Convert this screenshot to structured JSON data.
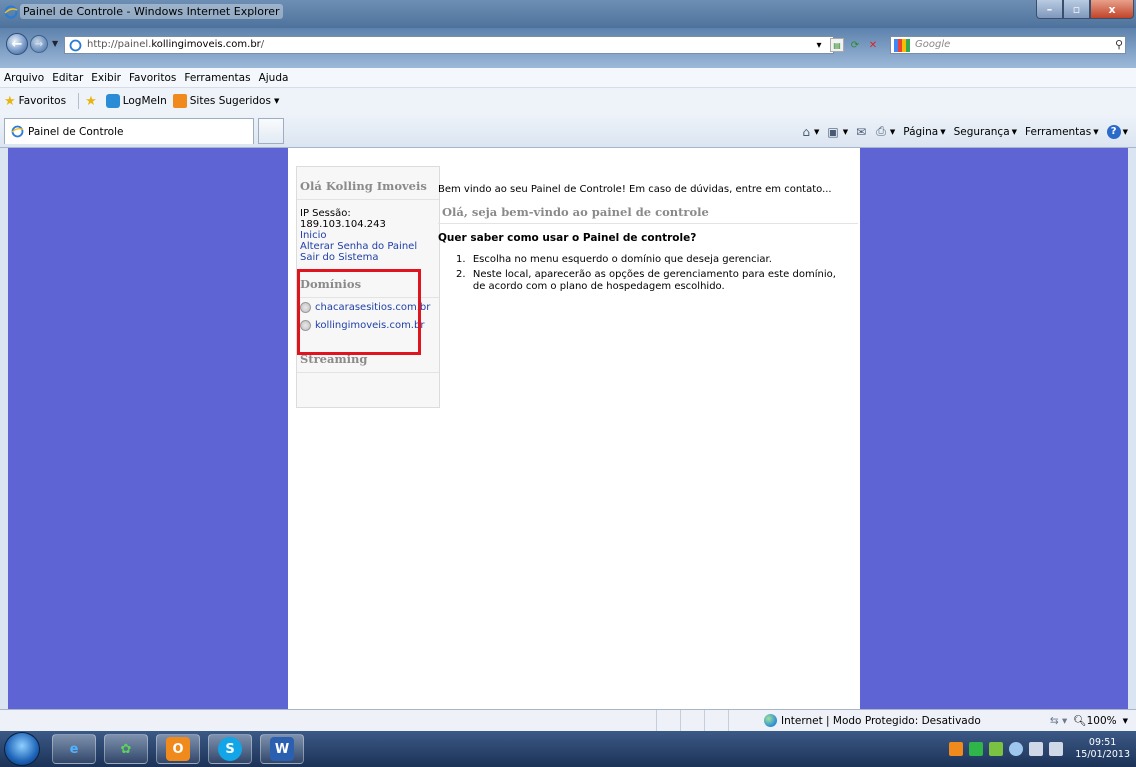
{
  "window": {
    "title": "Painel de Controle - Windows Internet Explorer",
    "controls": [
      "–",
      "▫",
      "x"
    ]
  },
  "address_bar": {
    "url_prefix": "http://painel.",
    "url_domain": "kollingimoveis.com.br",
    "url_suffix": "/",
    "search_placeholder": "Google"
  },
  "menu": [
    "Arquivo",
    "Editar",
    "Exibir",
    "Favoritos",
    "Ferramentas",
    "Ajuda"
  ],
  "favorites_bar": {
    "favorites_label": "Favoritos",
    "items": [
      "LogMeIn",
      "Sites Sugeridos"
    ]
  },
  "tab": {
    "label": "Painel de Controle"
  },
  "command_bar": {
    "page_label": "Página",
    "security_label": "Segurança",
    "tools_label": "Ferramentas"
  },
  "sidebar": {
    "greeting": "Olá Kolling Imoveis",
    "ip_session": "IP Sessão: 189.103.104.243",
    "links": [
      "Inicio",
      "Alterar Senha do Painel",
      "Sair do Sistema"
    ],
    "domains_title": "Domínios",
    "domains": [
      "chacarasesitios.com.br",
      "kollingimoveis.com.br"
    ],
    "streaming_title": "Streaming"
  },
  "main": {
    "welcome": "Bem vindo ao seu Painel de Controle! Em caso de dúvidas, entre em contato...",
    "greeting": "Olá, seja bem-vindo ao painel de controle",
    "howto_title": "Quer saber como usar o Painel de controle?",
    "steps": [
      {
        "num": "1.",
        "text": "Escolha no menu esquerdo o domínio que deseja gerenciar."
      },
      {
        "num": "2.",
        "text": "Neste local, aparecerão as opções de gerenciamento para este domínio, de acordo com o plano de hospedagem escolhido."
      }
    ]
  },
  "status_bar": {
    "zone": "Internet | Modo Protegido: Desativado",
    "zoom": "100%"
  },
  "taskbar": {
    "apps": [
      "internet-explorer",
      "messenger",
      "outlook",
      "skype",
      "word"
    ],
    "time": "09:51",
    "date": "15/01/2013"
  },
  "colors": {
    "page_background": "#5f64d4",
    "highlight": "#e0141f",
    "link": "#1f3fa8"
  }
}
